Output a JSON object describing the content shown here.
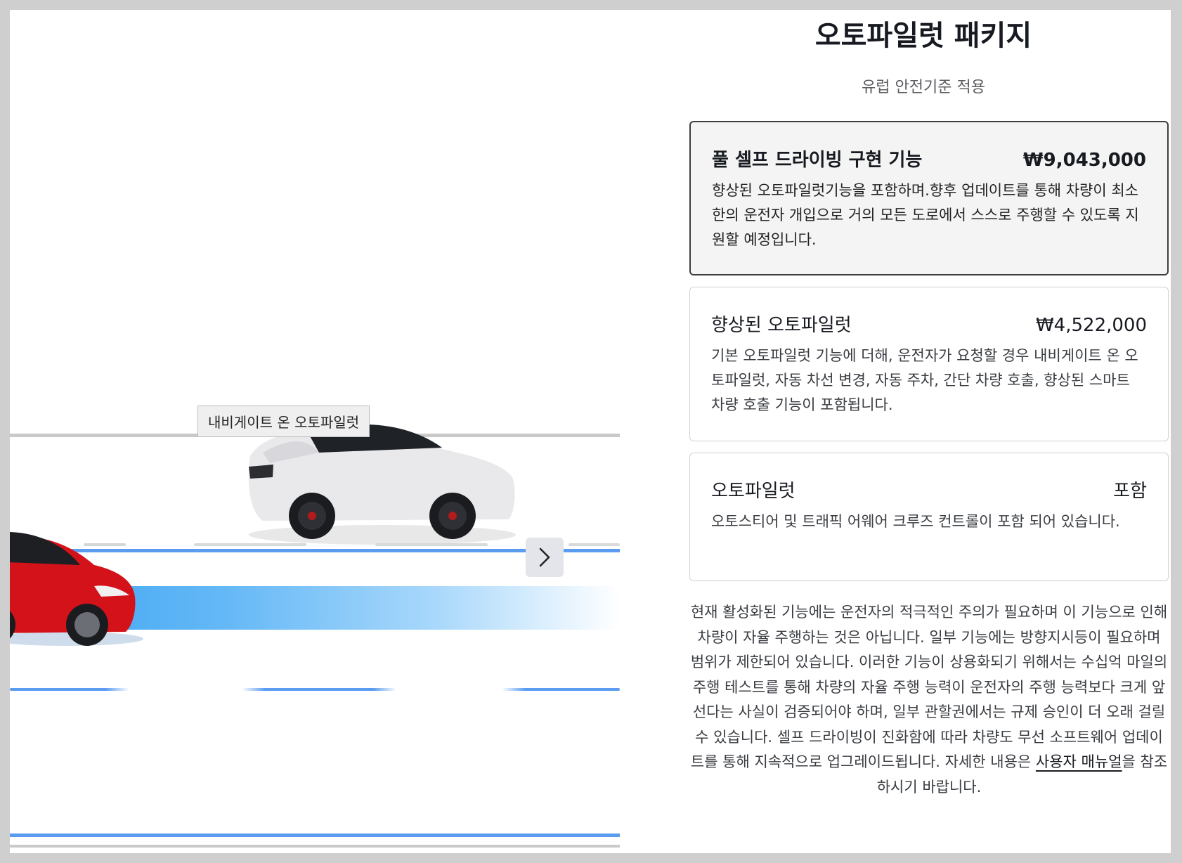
{
  "illustration": {
    "feature_label": "내비게이트 온 오토파일럿"
  },
  "header": {
    "title": "오토파일럿 패키지",
    "subtitle": "유럽 안전기준 적용"
  },
  "options": [
    {
      "name": "풀 셀프 드라이빙 구현 기능",
      "price": "₩9,043,000",
      "description": "향상된 오토파일럿기능을 포함하며.향후 업데이트를 통해 차량이 최소한의 운전자 개입으로 거의 모든 도로에서 스스로 주행할 수 있도록 지원할 예정입니다.",
      "selected": true
    },
    {
      "name": "향상된 오토파일럿",
      "price": "₩4,522,000",
      "description": "기본 오토파일럿 기능에 더해, 운전자가 요청할 경우 내비게이트 온 오토파일럿, 자동 차선 변경, 자동 주차, 간단 차량 호출, 향상된 스마트 차량 호출 기능이 포함됩니다.",
      "selected": false
    },
    {
      "name": "오토파일럿",
      "price": "포함",
      "description": "오토스티어 및 트래픽 어웨어 크루즈 컨트롤이 포함 되어 있습니다.",
      "selected": false
    }
  ],
  "disclaimer": {
    "text_before": "현재 활성화된 기능에는 운전자의 적극적인 주의가 필요하며 이 기능으로 인해 차량이 자율 주행하는 것은 아닙니다. 일부 기능에는 방향지시등이 필요하며 범위가 제한되어 있습니다. 이러한 기능이 상용화되기 위해서는 수십억 마일의 주행 테스트를 통해 차량의 자율 주행 능력이 운전자의 주행 능력보다 크게 앞선다는 사실이 검증되어야 하며, 일부 관할권에서는 규제 승인이 더 오래 걸릴 수 있습니다. 셀프 드라이빙이 진화함에 따라 차량도 무선 소프트웨어 업데이트를 통해 지속적으로 업그레이드됩니다. 자세한 내용은 ",
    "link": "사용자 매뉴얼",
    "text_after": "을 참조하시기 바랍니다."
  },
  "colors": {
    "lane_blue": "#5b9cf0",
    "car_white": "#e9e9ec",
    "car_red": "#d4121a",
    "selected_border": "#3e3e3e"
  }
}
